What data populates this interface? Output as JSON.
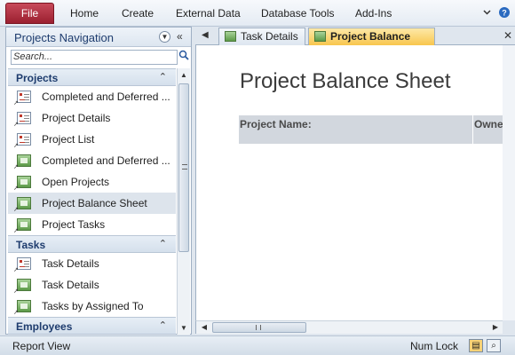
{
  "ribbon": {
    "file_label": "File",
    "tabs": [
      "Home",
      "Create",
      "External Data",
      "Database Tools",
      "Add-Ins"
    ],
    "icons": [
      "collapse-ribbon-icon",
      "help-icon"
    ]
  },
  "nav": {
    "title": "Projects Navigation",
    "search_placeholder": "Search...",
    "groups": [
      {
        "label": "Projects",
        "items": [
          {
            "label": "Completed and Deferred ...",
            "type": "form"
          },
          {
            "label": "Project Details",
            "type": "form"
          },
          {
            "label": "Project List",
            "type": "form"
          },
          {
            "label": "Completed and Deferred ...",
            "type": "report"
          },
          {
            "label": "Open Projects",
            "type": "report"
          },
          {
            "label": "Project Balance Sheet",
            "type": "report",
            "selected": true
          },
          {
            "label": "Project Tasks",
            "type": "report"
          }
        ]
      },
      {
        "label": "Tasks",
        "items": [
          {
            "label": "Task Details",
            "type": "form"
          },
          {
            "label": "Task Details",
            "type": "report"
          },
          {
            "label": "Tasks by Assigned To",
            "type": "report"
          }
        ]
      },
      {
        "label": "Employees",
        "items": []
      }
    ]
  },
  "doc_tabs": [
    {
      "label": "Task Details",
      "active": false
    },
    {
      "label": "Project Balance Sheet",
      "active": true
    }
  ],
  "report": {
    "title": "Project Balance Sheet",
    "header_label_1": "Project Name:",
    "header_label_2": "Owne"
  },
  "status": {
    "left": "Report View",
    "right": "Num Lock"
  },
  "colors": {
    "file_tab": "#b53244",
    "active_tab": "#f8c64e",
    "title_text": "#1e3c6e"
  }
}
